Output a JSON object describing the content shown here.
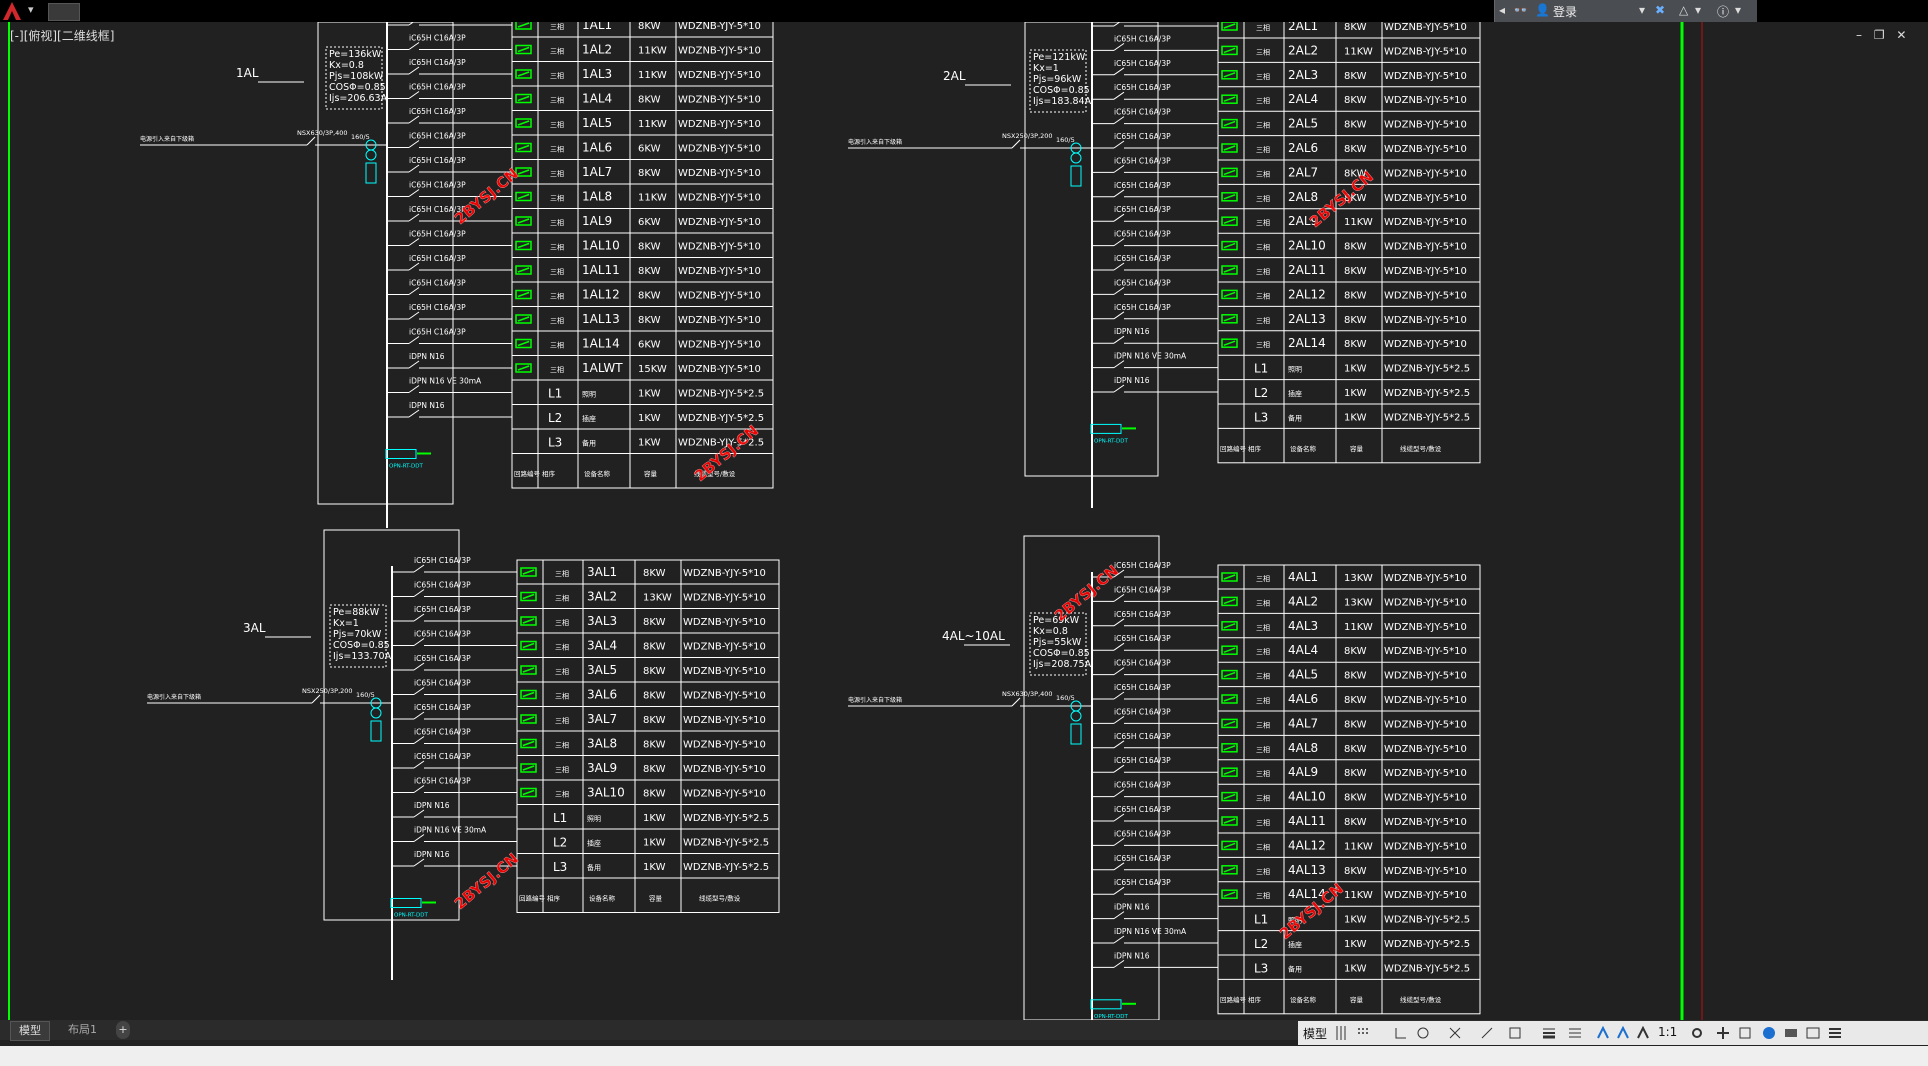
{
  "app": {
    "login_label": "登录",
    "viewport_label": "[-][俯视][二维线框]",
    "tabs": [
      "模型",
      "布局1",
      "+"
    ],
    "status_model": "模型",
    "scale": "1:1",
    "colors": {
      "background": "#212121",
      "green": "#00ff00",
      "cyan": "#00ffff",
      "line": "#ffffff",
      "watermark": "#ff0000"
    }
  },
  "watermark": "2BYSJ.CN",
  "panels": [
    {
      "id": "1AL",
      "label": "1AL",
      "info": [
        "Pe=136kW",
        "Kx=0.8",
        "Pjs=108kW",
        "COSΦ=0.85",
        "Ijs=206.63A"
      ],
      "incoming": "电源引入来自下级箱",
      "breaker": "NSX630/3P,400",
      "meter": "160/5",
      "spd": "OPN-RT-DDT",
      "breakers": [
        "iC65H C16A/3P",
        "iC65H C16A/3P",
        "iC65H C16A/3P",
        "iC65H C16A/3P",
        "iC65H C16A/3P",
        "iC65H C16A/3P",
        "iC65H C16A/3P",
        "iC65H C16A/3P",
        "iC65H C16A/3P",
        "iC65H C16A/3P",
        "iC65H C16A/3P",
        "iC65H C16A/3P",
        "iC65H C16A/3P",
        "iC65H C16A/3P",
        "iDPN N16",
        "iDPN N16 VE 30mA",
        "iDPN N16"
      ],
      "rows": [
        [
          "三相",
          "1AL1",
          "8KW",
          "WDZNB-YJY-5*10"
        ],
        [
          "三相",
          "1AL2",
          "11KW",
          "WDZNB-YJY-5*10"
        ],
        [
          "三相",
          "1AL3",
          "11KW",
          "WDZNB-YJY-5*10"
        ],
        [
          "三相",
          "1AL4",
          "8KW",
          "WDZNB-YJY-5*10"
        ],
        [
          "三相",
          "1AL5",
          "11KW",
          "WDZNB-YJY-5*10"
        ],
        [
          "三相",
          "1AL6",
          "6KW",
          "WDZNB-YJY-5*10"
        ],
        [
          "三相",
          "1AL7",
          "8KW",
          "WDZNB-YJY-5*10"
        ],
        [
          "三相",
          "1AL8",
          "11KW",
          "WDZNB-YJY-5*10"
        ],
        [
          "三相",
          "1AL9",
          "6KW",
          "WDZNB-YJY-5*10"
        ],
        [
          "三相",
          "1AL10",
          "8KW",
          "WDZNB-YJY-5*10"
        ],
        [
          "三相",
          "1AL11",
          "8KW",
          "WDZNB-YJY-5*10"
        ],
        [
          "三相",
          "1AL12",
          "8KW",
          "WDZNB-YJY-5*10"
        ],
        [
          "三相",
          "1AL13",
          "8KW",
          "WDZNB-YJY-5*10"
        ],
        [
          "三相",
          "1AL14",
          "6KW",
          "WDZNB-YJY-5*10"
        ],
        [
          "三相",
          "1ALWT",
          "15KW",
          "WDZNB-YJY-5*10"
        ],
        [
          "L1",
          "照明",
          "1KW",
          "WDZNB-YJY-5*2.5"
        ],
        [
          "L2",
          "插座",
          "1KW",
          "WDZNB-YJY-5*2.5"
        ],
        [
          "L3",
          "备用",
          "1KW",
          "WDZNB-YJY-5*2.5"
        ]
      ],
      "header": [
        "回路编号",
        "相序",
        "设备名称",
        "容量",
        "线缆型号/敷设"
      ]
    },
    {
      "id": "2AL",
      "label": "2AL",
      "info": [
        "Pe=121kW",
        "Kx=1",
        "Pjs=96kW",
        "COSΦ=0.85",
        "Ijs=183.84A"
      ],
      "incoming": "电源引入来自下级箱",
      "breaker": "NSX250/3P,200",
      "meter": "160/5",
      "spd": "OPN-RT-DDT",
      "breakers": [
        "iC65H C16A/3P",
        "iC65H C16A/3P",
        "iC65H C16A/3P",
        "iC65H C16A/3P",
        "iC65H C16A/3P",
        "iC65H C16A/3P",
        "iC65H C16A/3P",
        "iC65H C16A/3P",
        "iC65H C16A/3P",
        "iC65H C16A/3P",
        "iC65H C16A/3P",
        "iC65H C16A/3P",
        "iC65H C16A/3P",
        "iDPN N16",
        "iDPN N16 VE 30mA",
        "iDPN N16"
      ],
      "rows": [
        [
          "三相",
          "2AL1",
          "8KW",
          "WDZNB-YJY-5*10"
        ],
        [
          "三相",
          "2AL2",
          "11KW",
          "WDZNB-YJY-5*10"
        ],
        [
          "三相",
          "2AL3",
          "8KW",
          "WDZNB-YJY-5*10"
        ],
        [
          "三相",
          "2AL4",
          "8KW",
          "WDZNB-YJY-5*10"
        ],
        [
          "三相",
          "2AL5",
          "8KW",
          "WDZNB-YJY-5*10"
        ],
        [
          "三相",
          "2AL6",
          "8KW",
          "WDZNB-YJY-5*10"
        ],
        [
          "三相",
          "2AL7",
          "8KW",
          "WDZNB-YJY-5*10"
        ],
        [
          "三相",
          "2AL8",
          "8KW",
          "WDZNB-YJY-5*10"
        ],
        [
          "三相",
          "2AL9",
          "11KW",
          "WDZNB-YJY-5*10"
        ],
        [
          "三相",
          "2AL10",
          "8KW",
          "WDZNB-YJY-5*10"
        ],
        [
          "三相",
          "2AL11",
          "8KW",
          "WDZNB-YJY-5*10"
        ],
        [
          "三相",
          "2AL12",
          "8KW",
          "WDZNB-YJY-5*10"
        ],
        [
          "三相",
          "2AL13",
          "8KW",
          "WDZNB-YJY-5*10"
        ],
        [
          "三相",
          "2AL14",
          "8KW",
          "WDZNB-YJY-5*10"
        ],
        [
          "L1",
          "照明",
          "1KW",
          "WDZNB-YJY-5*2.5"
        ],
        [
          "L2",
          "插座",
          "1KW",
          "WDZNB-YJY-5*2.5"
        ],
        [
          "L3",
          "备用",
          "1KW",
          "WDZNB-YJY-5*2.5"
        ]
      ],
      "header": [
        "回路编号",
        "相序",
        "设备名称",
        "容量",
        "线缆型号/敷设"
      ]
    },
    {
      "id": "3AL",
      "label": "3AL",
      "info": [
        "Pe=88kW",
        "Kx=1",
        "Pjs=70kW",
        "COSΦ=0.85",
        "Ijs=133.70A"
      ],
      "incoming": "电源引入来自下级箱",
      "breaker": "NSX250/3P,200",
      "meter": "160/5",
      "spd": "OPN-RT-DDT",
      "breakers": [
        "iC65H C16A/3P",
        "iC65H C16A/3P",
        "iC65H C16A/3P",
        "iC65H C16A/3P",
        "iC65H C16A/3P",
        "iC65H C16A/3P",
        "iC65H C16A/3P",
        "iC65H C16A/3P",
        "iC65H C16A/3P",
        "iC65H C16A/3P",
        "iDPN N16",
        "iDPN N16 VE 30mA",
        "iDPN N16"
      ],
      "rows": [
        [
          "三相",
          "3AL1",
          "8KW",
          "WDZNB-YJY-5*10"
        ],
        [
          "三相",
          "3AL2",
          "13KW",
          "WDZNB-YJY-5*10"
        ],
        [
          "三相",
          "3AL3",
          "8KW",
          "WDZNB-YJY-5*10"
        ],
        [
          "三相",
          "3AL4",
          "8KW",
          "WDZNB-YJY-5*10"
        ],
        [
          "三相",
          "3AL5",
          "8KW",
          "WDZNB-YJY-5*10"
        ],
        [
          "三相",
          "3AL6",
          "8KW",
          "WDZNB-YJY-5*10"
        ],
        [
          "三相",
          "3AL7",
          "8KW",
          "WDZNB-YJY-5*10"
        ],
        [
          "三相",
          "3AL8",
          "8KW",
          "WDZNB-YJY-5*10"
        ],
        [
          "三相",
          "3AL9",
          "8KW",
          "WDZNB-YJY-5*10"
        ],
        [
          "三相",
          "3AL10",
          "8KW",
          "WDZNB-YJY-5*10"
        ],
        [
          "L1",
          "照明",
          "1KW",
          "WDZNB-YJY-5*2.5"
        ],
        [
          "L2",
          "插座",
          "1KW",
          "WDZNB-YJY-5*2.5"
        ],
        [
          "L3",
          "备用",
          "1KW",
          "WDZNB-YJY-5*2.5"
        ]
      ],
      "header": [
        "回路编号",
        "相序",
        "设备名称",
        "容量",
        "线缆型号/敷设"
      ]
    },
    {
      "id": "4AL",
      "label": "4AL~10AL",
      "info": [
        "Pe=69kW",
        "Kx=0.8",
        "Pjs=55kW",
        "COSΦ=0.85",
        "Ijs=208.75A"
      ],
      "incoming": "电源引入来自下级箱",
      "breaker": "NSX630/3P,400",
      "meter": "160/5",
      "spd": "OPN-RT-DDT",
      "breakers": [
        "iC65H C16A/3P",
        "iC65H C16A/3P",
        "iC65H C16A/3P",
        "iC65H C16A/3P",
        "iC65H C16A/3P",
        "iC65H C16A/3P",
        "iC65H C16A/3P",
        "iC65H C16A/3P",
        "iC65H C16A/3P",
        "iC65H C16A/3P",
        "iC65H C16A/3P",
        "iC65H C16A/3P",
        "iC65H C16A/3P",
        "iC65H C16A/3P",
        "iDPN N16",
        "iDPN N16 VE 30mA",
        "iDPN N16"
      ],
      "rows": [
        [
          "三相",
          "4AL1",
          "13KW",
          "WDZNB-YJY-5*10"
        ],
        [
          "三相",
          "4AL2",
          "13KW",
          "WDZNB-YJY-5*10"
        ],
        [
          "三相",
          "4AL3",
          "11KW",
          "WDZNB-YJY-5*10"
        ],
        [
          "三相",
          "4AL4",
          "8KW",
          "WDZNB-YJY-5*10"
        ],
        [
          "三相",
          "4AL5",
          "8KW",
          "WDZNB-YJY-5*10"
        ],
        [
          "三相",
          "4AL6",
          "8KW",
          "WDZNB-YJY-5*10"
        ],
        [
          "三相",
          "4AL7",
          "8KW",
          "WDZNB-YJY-5*10"
        ],
        [
          "三相",
          "4AL8",
          "8KW",
          "WDZNB-YJY-5*10"
        ],
        [
          "三相",
          "4AL9",
          "8KW",
          "WDZNB-YJY-5*10"
        ],
        [
          "三相",
          "4AL10",
          "8KW",
          "WDZNB-YJY-5*10"
        ],
        [
          "三相",
          "4AL11",
          "8KW",
          "WDZNB-YJY-5*10"
        ],
        [
          "三相",
          "4AL12",
          "11KW",
          "WDZNB-YJY-5*10"
        ],
        [
          "三相",
          "4AL13",
          "8KW",
          "WDZNB-YJY-5*10"
        ],
        [
          "三相",
          "4AL14",
          "11KW",
          "WDZNB-YJY-5*10"
        ],
        [
          "L1",
          "照明",
          "1KW",
          "WDZNB-YJY-5*2.5"
        ],
        [
          "L2",
          "插座",
          "1KW",
          "WDZNB-YJY-5*2.5"
        ],
        [
          "L3",
          "备用",
          "1KW",
          "WDZNB-YJY-5*2.5"
        ]
      ],
      "header": [
        "回路编号",
        "相序",
        "设备名称",
        "容量",
        "线缆型号/敷设"
      ]
    }
  ]
}
